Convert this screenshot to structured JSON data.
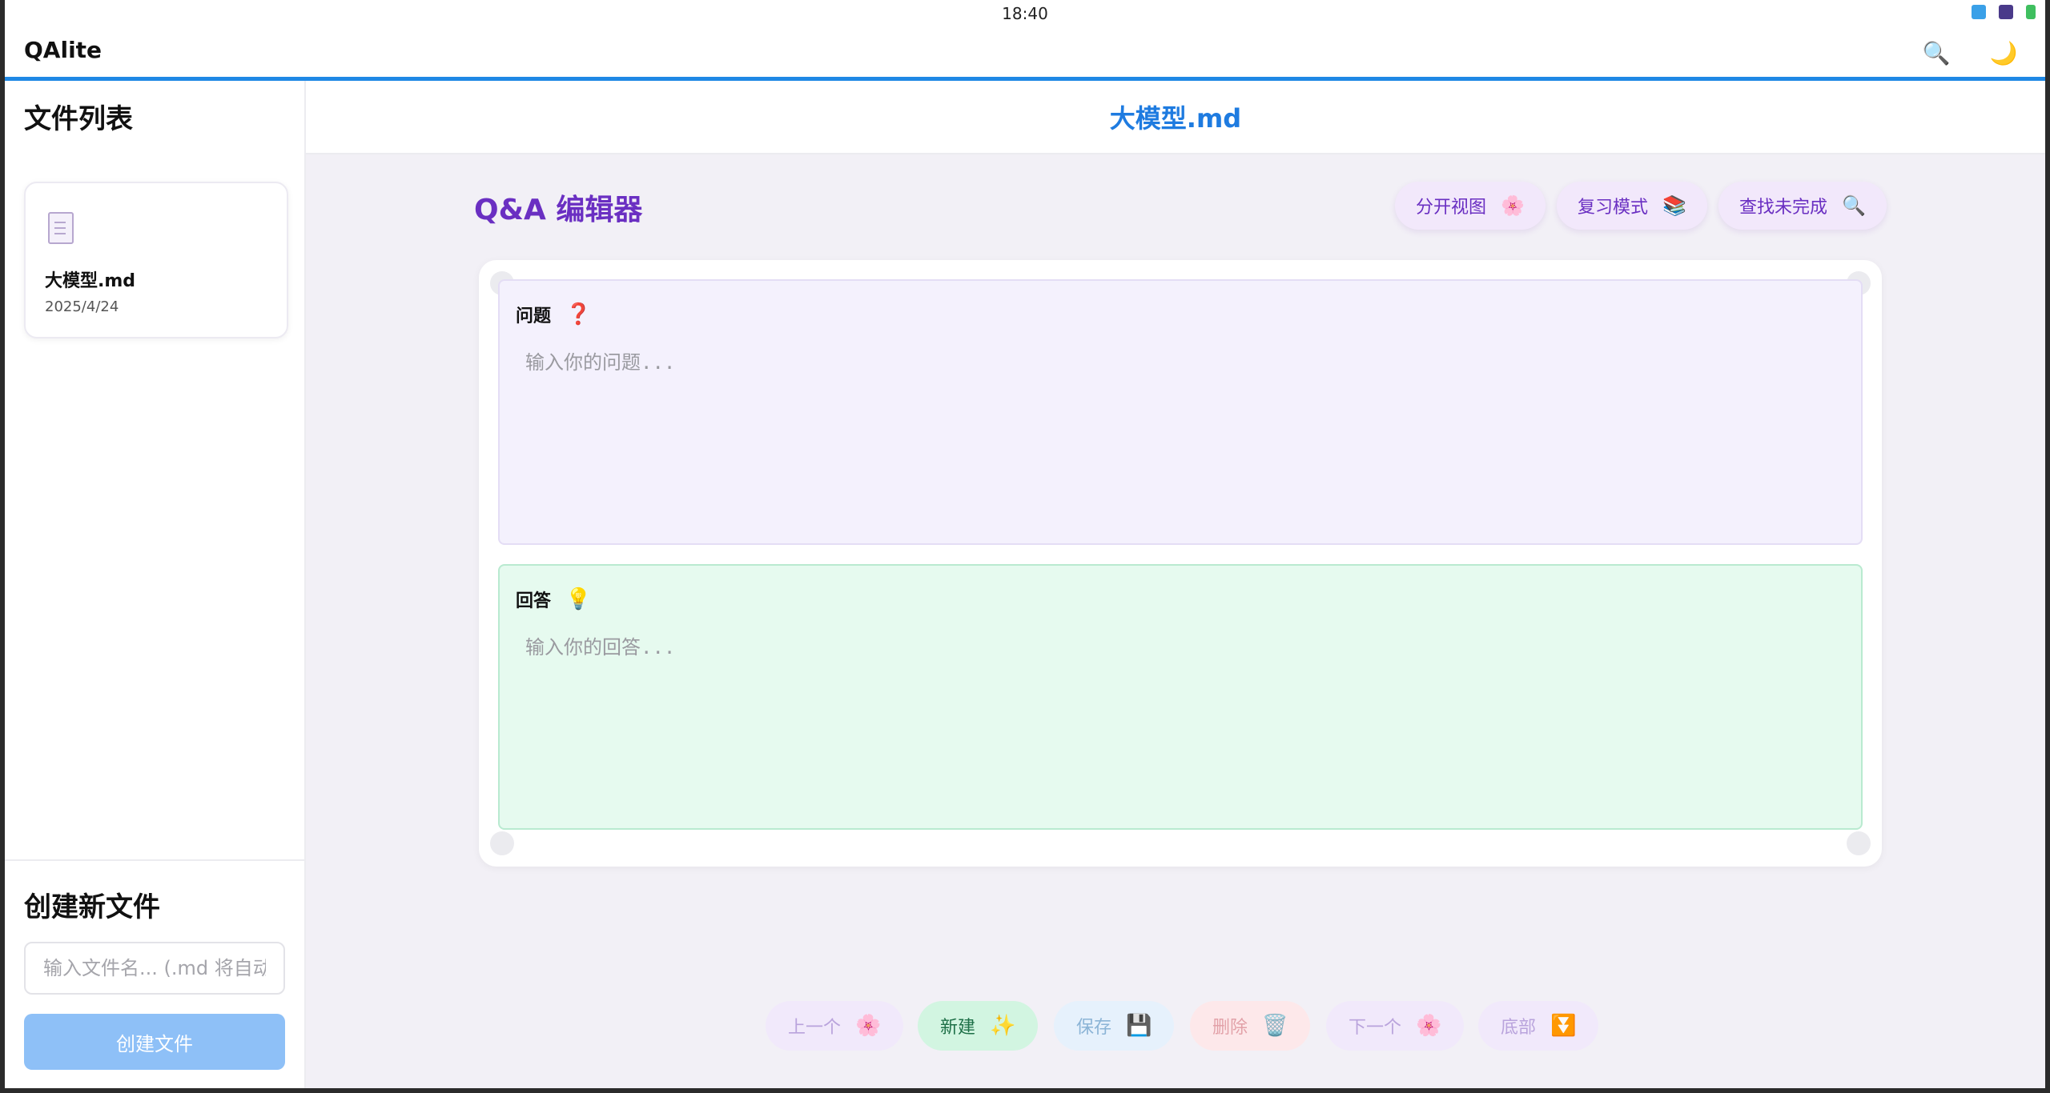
{
  "status_bar": {
    "time": "18:40"
  },
  "app": {
    "title": "QAlite",
    "search_icon": "🔍",
    "theme_icon": "🌙"
  },
  "sidebar": {
    "title": "文件列表",
    "files": [
      {
        "name": "大模型.md",
        "date": "2025/4/24"
      }
    ],
    "create_title": "创建新文件",
    "input_placeholder": "输入文件名... (.md 将自动添加)",
    "create_button": "创建文件"
  },
  "main": {
    "doc_title": "大模型.md",
    "editor_title": "Q&A 编辑器",
    "toolbar": [
      {
        "label": "分开视图",
        "icon": "🌸"
      },
      {
        "label": "复习模式",
        "icon": "📚"
      },
      {
        "label": "查找未完成",
        "icon": "🔍"
      }
    ],
    "question": {
      "label": "问题",
      "icon": "❓",
      "placeholder": "输入你的问题...",
      "value": ""
    },
    "answer": {
      "label": "回答",
      "icon": "💡",
      "placeholder": "输入你的回答...",
      "value": ""
    }
  },
  "bottom_nav": [
    {
      "label": "上一个",
      "icon": "🌸"
    },
    {
      "label": "新建",
      "icon": "✨"
    },
    {
      "label": "保存",
      "icon": "💾"
    },
    {
      "label": "删除",
      "icon": "🗑️"
    },
    {
      "label": "下一个",
      "icon": "🌸"
    },
    {
      "label": "底部",
      "icon": "⏬"
    }
  ],
  "colors": {
    "accent_blue": "#1e88e5",
    "doc_title": "#1e7be0",
    "editor_title": "#6a2fc2",
    "question_bg": "#f4f1fd",
    "answer_bg": "#e6faef",
    "create_button_bg": "#8ec0f7"
  }
}
